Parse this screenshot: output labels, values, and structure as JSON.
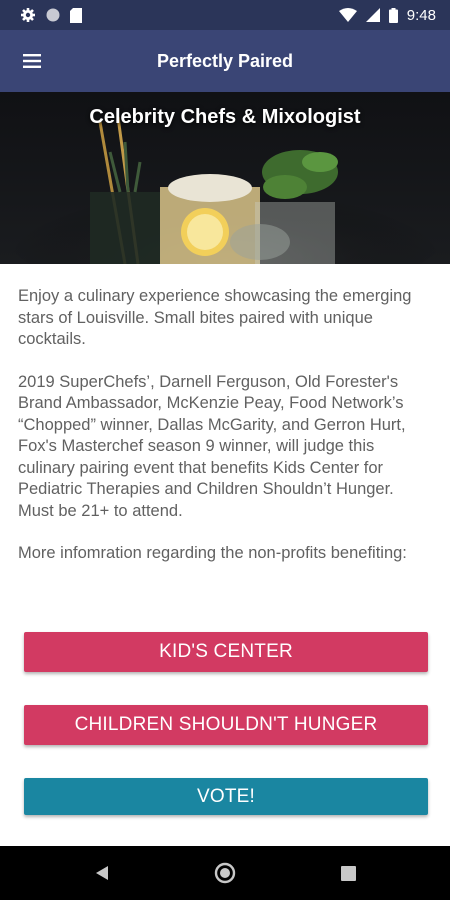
{
  "status_bar": {
    "time": "9:48",
    "icons": [
      "gear-icon",
      "circle-icon",
      "sd-card-icon",
      "wifi-icon",
      "signal-icon",
      "battery-icon"
    ]
  },
  "app_bar": {
    "title": "Perfectly Paired",
    "menu_icon": "hamburger-icon"
  },
  "hero": {
    "title": "Celebrity Chefs & Mixologist"
  },
  "content": {
    "paragraphs": [
      "Enjoy a culinary experience showcasing the emerging stars of Louisville. Small bites paired with unique cocktails.",
      "2019 SuperChefs’, Darnell Ferguson, Old Forester's Brand Ambassador, McKenzie Peay, Food Network’s “Chopped” winner, Dallas McGarity, and Gerron Hurt, Fox's Masterchef season 9 winner, will judge this culinary pairing event that benefits Kids Center for Pediatric Therapies and Children Shouldn’t Hunger. Must be 21+ to attend.",
      "More infomration regarding the non-profits benefiting:"
    ]
  },
  "buttons": {
    "kids_center": "KID'S CENTER",
    "children_hunger": "CHILDREN SHOULDN'T HUNGER",
    "vote": "VOTE!"
  },
  "colors": {
    "status_bar": "#2b3559",
    "app_bar": "#3a4575",
    "button_pink": "#d23a62",
    "button_teal": "#1a86a1"
  },
  "nav_bar": {
    "icons": [
      "back-icon",
      "home-icon",
      "recents-icon"
    ]
  }
}
